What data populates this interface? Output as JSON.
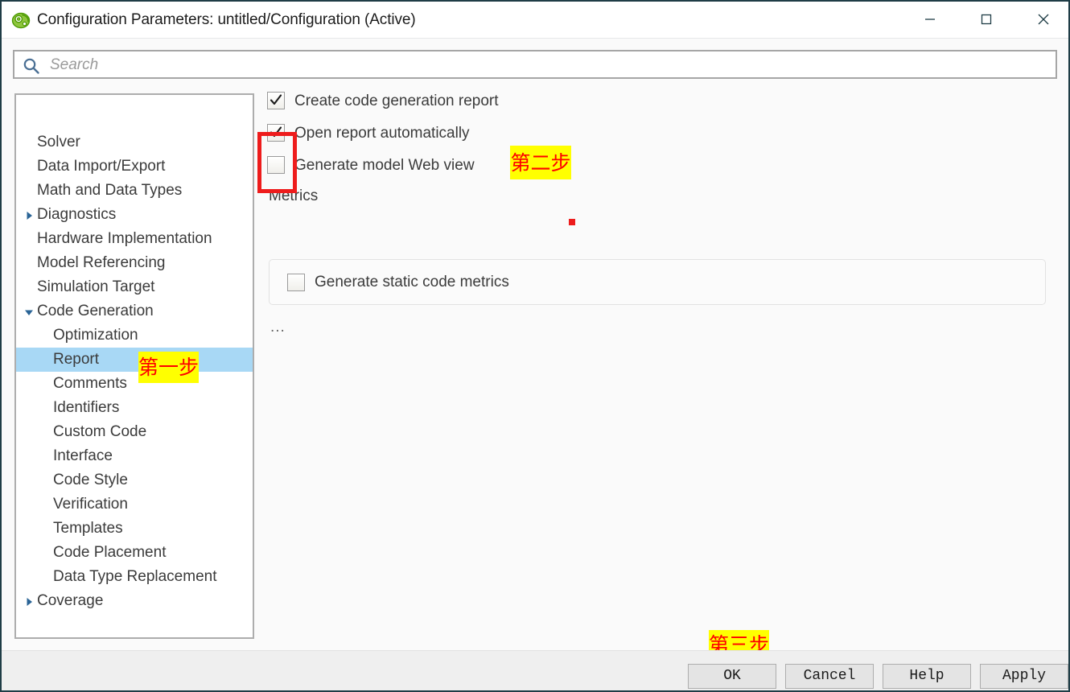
{
  "window": {
    "title": "Configuration Parameters: untitled/Configuration (Active)",
    "app_icon": "simulink-gear-icon",
    "controls": {
      "minimize": "minimize-icon",
      "maximize": "maximize-icon",
      "close": "close-icon"
    }
  },
  "search": {
    "placeholder": "Search",
    "value": "",
    "icon": "search-icon"
  },
  "tree": {
    "items": [
      {
        "label": "Solver",
        "level": 0,
        "arrow": "none",
        "selected": false
      },
      {
        "label": "Data Import/Export",
        "level": 0,
        "arrow": "none",
        "selected": false
      },
      {
        "label": "Math and Data Types",
        "level": 0,
        "arrow": "none",
        "selected": false
      },
      {
        "label": "Diagnostics",
        "level": 0,
        "arrow": "collapsed",
        "selected": false
      },
      {
        "label": "Hardware Implementation",
        "level": 0,
        "arrow": "none",
        "selected": false
      },
      {
        "label": "Model Referencing",
        "level": 0,
        "arrow": "none",
        "selected": false
      },
      {
        "label": "Simulation Target",
        "level": 0,
        "arrow": "none",
        "selected": false
      },
      {
        "label": "Code Generation",
        "level": 0,
        "arrow": "expanded",
        "selected": false
      },
      {
        "label": "Optimization",
        "level": 1,
        "arrow": "none",
        "selected": false
      },
      {
        "label": "Report",
        "level": 1,
        "arrow": "none",
        "selected": true
      },
      {
        "label": "Comments",
        "level": 1,
        "arrow": "none",
        "selected": false
      },
      {
        "label": "Identifiers",
        "level": 1,
        "arrow": "none",
        "selected": false
      },
      {
        "label": "Custom Code",
        "level": 1,
        "arrow": "none",
        "selected": false
      },
      {
        "label": "Interface",
        "level": 1,
        "arrow": "none",
        "selected": false
      },
      {
        "label": "Code Style",
        "level": 1,
        "arrow": "none",
        "selected": false
      },
      {
        "label": "Verification",
        "level": 1,
        "arrow": "none",
        "selected": false
      },
      {
        "label": "Templates",
        "level": 1,
        "arrow": "none",
        "selected": false
      },
      {
        "label": "Code Placement",
        "level": 1,
        "arrow": "none",
        "selected": false
      },
      {
        "label": "Data Type Replacement",
        "level": 1,
        "arrow": "none",
        "selected": false
      },
      {
        "label": "Coverage",
        "level": 0,
        "arrow": "collapsed",
        "selected": false
      }
    ]
  },
  "options": {
    "checkboxes": [
      {
        "label": "Create code generation report",
        "checked": true
      },
      {
        "label": "Open report automatically",
        "checked": true
      },
      {
        "label": "Generate model Web view",
        "checked": false
      }
    ],
    "metrics_group_label": "Metrics",
    "metrics_checkbox": {
      "label": "Generate static code metrics",
      "checked": false
    },
    "ellipsis": "..."
  },
  "footer": {
    "buttons": [
      {
        "label": "OK"
      },
      {
        "label": "Cancel"
      },
      {
        "label": "Help"
      },
      {
        "label": "Apply"
      }
    ]
  },
  "annotations": {
    "step1": "第一步",
    "step2": "第二步",
    "step3": "第三步",
    "highlight_color": "#ffff00",
    "text_color": "#fe0000",
    "rect_color": "#ee1c1c",
    "marker_color": "#ed1c1c"
  }
}
